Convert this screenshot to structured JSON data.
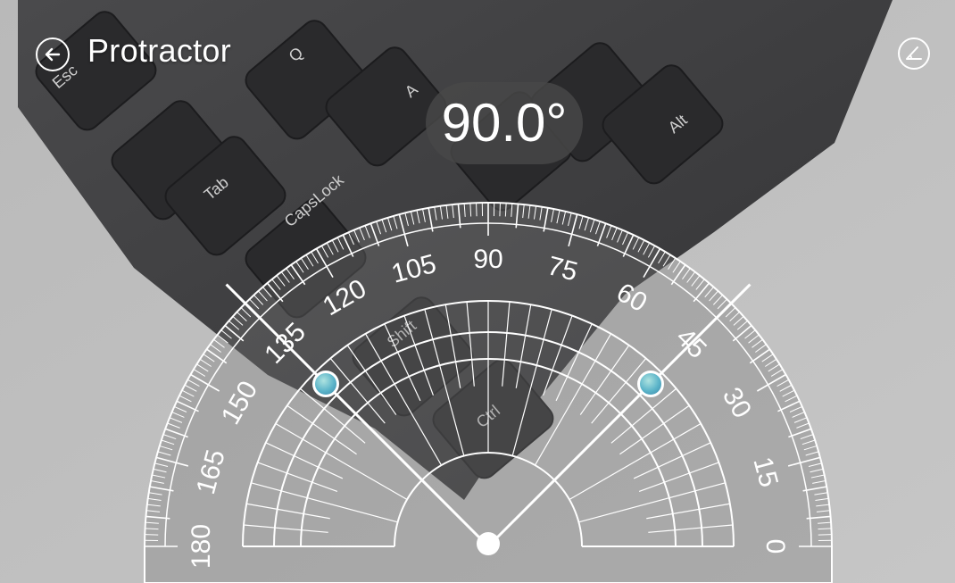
{
  "app": {
    "title": "Protractor",
    "back_icon": "arrow-left-circle-icon",
    "reset_icon": "angle-reset-icon"
  },
  "measurement": {
    "angle_text": "90.0°",
    "arm_a_deg": 135,
    "arm_b_deg": 45
  },
  "protractor": {
    "outer_labels": [
      "0",
      "15",
      "30",
      "45",
      "60",
      "75",
      "90",
      "105",
      "120",
      "135",
      "150",
      "165",
      "180"
    ],
    "major_step_deg": 15,
    "minor_step_deg": 1
  },
  "camera_keys": [
    "Esc",
    "Q",
    "A",
    "Tab",
    "CapsLock",
    "Shift",
    "Ctrl",
    "Alt"
  ],
  "colors": {
    "handle": "#5bb4c9",
    "overlay": "#ffffff",
    "pill_bg": "#484848"
  }
}
